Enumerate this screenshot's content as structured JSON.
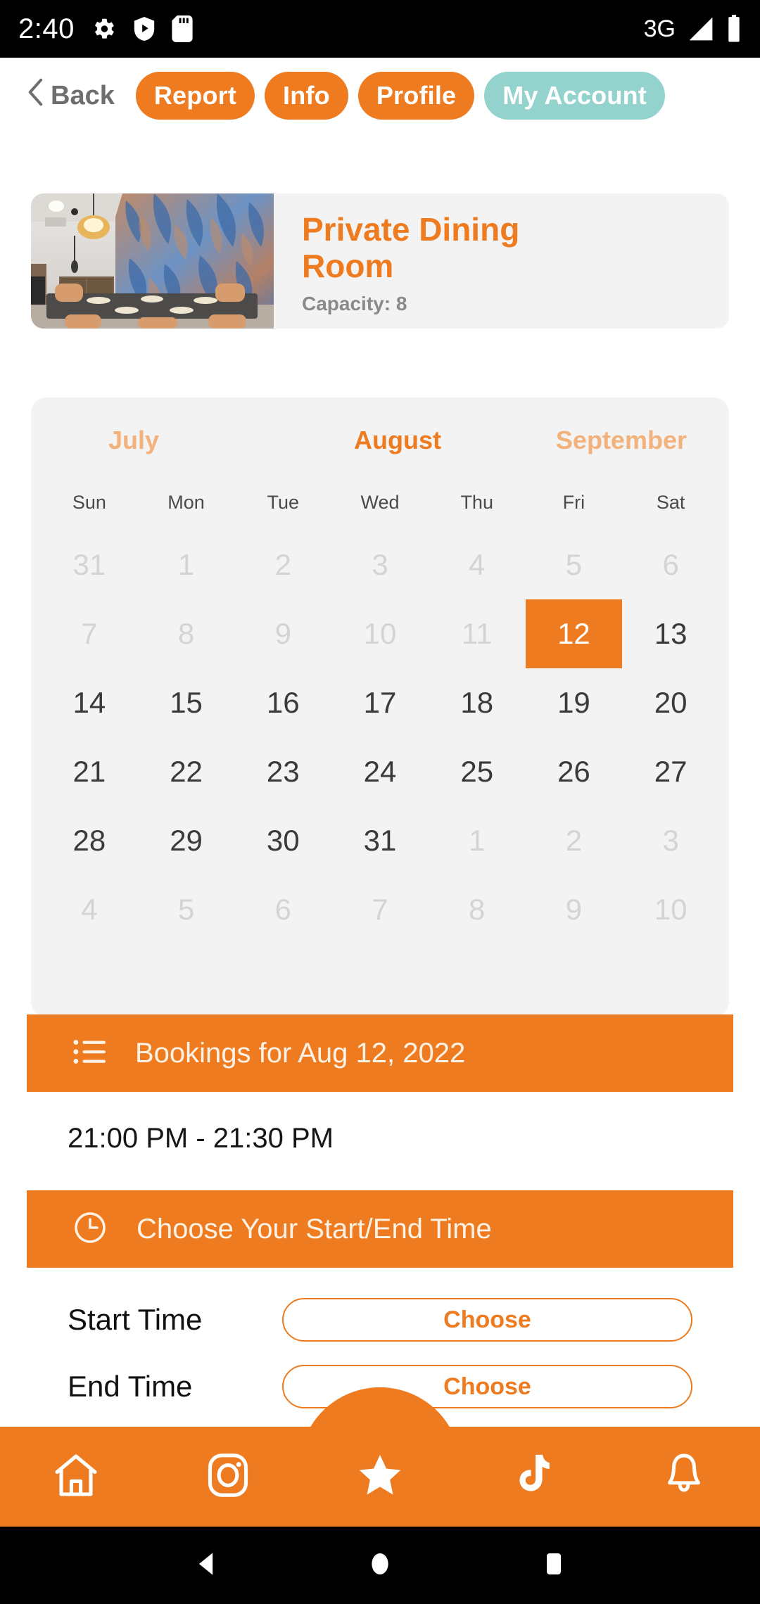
{
  "status_bar": {
    "time": "2:40",
    "network": "3G",
    "icons": [
      "settings-gear-icon",
      "play-protect-shield-icon",
      "sd-card-icon",
      "signal-icon",
      "battery-icon"
    ]
  },
  "top_nav": {
    "back_label": "Back",
    "pills": [
      {
        "label": "Report",
        "style": "orange"
      },
      {
        "label": "Info",
        "style": "orange"
      },
      {
        "label": "Profile",
        "style": "orange"
      },
      {
        "label": "My Account",
        "style": "teal"
      }
    ]
  },
  "room_card": {
    "title": "Private Dining Room",
    "capacity": "Capacity: 8"
  },
  "calendar": {
    "months": [
      {
        "label": "July",
        "state": "prev"
      },
      {
        "label": "August",
        "state": "current"
      },
      {
        "label": "September",
        "state": "next"
      }
    ],
    "day_names": [
      "Sun",
      "Mon",
      "Tue",
      "Wed",
      "Thu",
      "Fri",
      "Sat"
    ],
    "weeks": [
      [
        {
          "d": "31",
          "s": "muted"
        },
        {
          "d": "1",
          "s": "muted"
        },
        {
          "d": "2",
          "s": "muted"
        },
        {
          "d": "3",
          "s": "muted"
        },
        {
          "d": "4",
          "s": "muted"
        },
        {
          "d": "5",
          "s": "muted"
        },
        {
          "d": "6",
          "s": "muted"
        }
      ],
      [
        {
          "d": "7",
          "s": "muted"
        },
        {
          "d": "8",
          "s": "muted"
        },
        {
          "d": "9",
          "s": "muted"
        },
        {
          "d": "10",
          "s": "muted"
        },
        {
          "d": "11",
          "s": "muted"
        },
        {
          "d": "12",
          "s": "selected"
        },
        {
          "d": "13",
          "s": "normal"
        }
      ],
      [
        {
          "d": "14",
          "s": "normal"
        },
        {
          "d": "15",
          "s": "normal"
        },
        {
          "d": "16",
          "s": "normal"
        },
        {
          "d": "17",
          "s": "normal"
        },
        {
          "d": "18",
          "s": "normal"
        },
        {
          "d": "19",
          "s": "normal"
        },
        {
          "d": "20",
          "s": "normal"
        }
      ],
      [
        {
          "d": "21",
          "s": "normal"
        },
        {
          "d": "22",
          "s": "normal"
        },
        {
          "d": "23",
          "s": "normal"
        },
        {
          "d": "24",
          "s": "normal"
        },
        {
          "d": "25",
          "s": "normal"
        },
        {
          "d": "26",
          "s": "normal"
        },
        {
          "d": "27",
          "s": "normal"
        }
      ],
      [
        {
          "d": "28",
          "s": "normal"
        },
        {
          "d": "29",
          "s": "normal"
        },
        {
          "d": "30",
          "s": "normal"
        },
        {
          "d": "31",
          "s": "normal"
        },
        {
          "d": "1",
          "s": "muted"
        },
        {
          "d": "2",
          "s": "muted"
        },
        {
          "d": "3",
          "s": "muted"
        }
      ],
      [
        {
          "d": "4",
          "s": "muted"
        },
        {
          "d": "5",
          "s": "muted"
        },
        {
          "d": "6",
          "s": "muted"
        },
        {
          "d": "7",
          "s": "muted"
        },
        {
          "d": "8",
          "s": "muted"
        },
        {
          "d": "9",
          "s": "muted"
        },
        {
          "d": "10",
          "s": "muted"
        }
      ]
    ]
  },
  "bookings": {
    "header": "Bookings for Aug 12, 2022",
    "header_icon": "list-icon",
    "slots": [
      "21:00 PM - 21:30 PM"
    ]
  },
  "time_picker": {
    "header": "Choose Your Start/End Time",
    "header_icon": "clock-icon",
    "start_label": "Start Time",
    "start_button": "Choose",
    "end_label": "End Time",
    "end_button": "Choose"
  },
  "tab_bar": {
    "tabs": [
      {
        "icon": "home-icon"
      },
      {
        "icon": "instagram-icon"
      },
      {
        "icon": "star-icon"
      },
      {
        "icon": "tiktok-icon"
      },
      {
        "icon": "bell-icon"
      }
    ]
  },
  "nav_bar": {
    "keys": [
      {
        "icon": "back-triangle-icon"
      },
      {
        "icon": "home-circle-icon"
      },
      {
        "icon": "recents-square-icon"
      }
    ]
  },
  "colors": {
    "accent_orange": "#ee7b1f",
    "accent_teal": "#93d2cd",
    "panel_gray": "#f3f3f3",
    "muted_day": "#d4d4d4"
  }
}
